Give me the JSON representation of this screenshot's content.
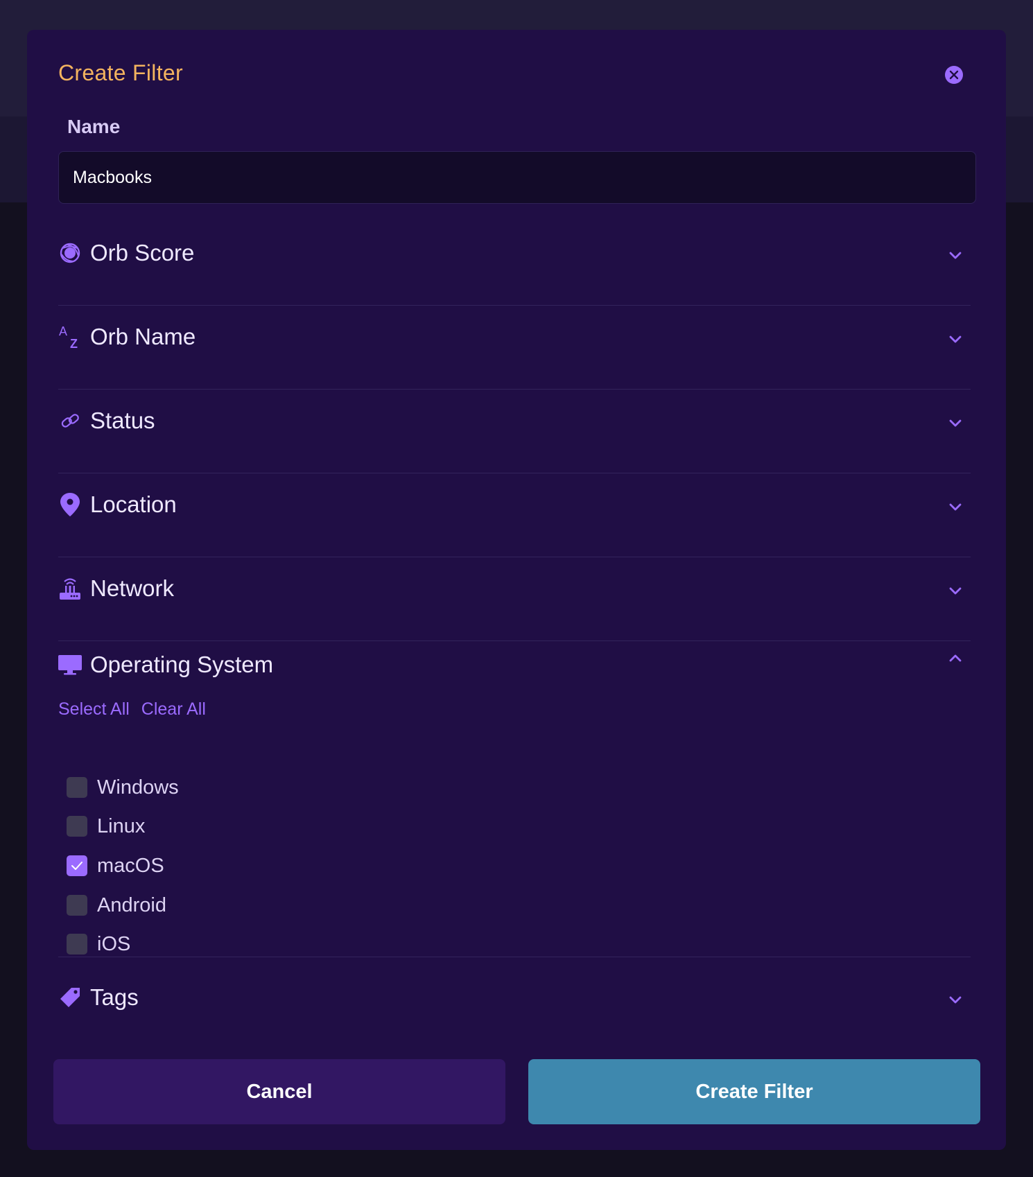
{
  "modal": {
    "title": "Create Filter",
    "name_label": "Name",
    "name_value": "Macbooks"
  },
  "sections": [
    {
      "label": "Orb Score",
      "icon": "orb-score-icon"
    },
    {
      "label": "Orb Name",
      "icon": "az-sort-icon"
    },
    {
      "label": "Status",
      "icon": "link-icon"
    },
    {
      "label": "Location",
      "icon": "map-pin-icon"
    },
    {
      "label": "Network",
      "icon": "router-icon"
    }
  ],
  "os": {
    "label": "Operating System",
    "icon": "monitor-icon",
    "select_all": "Select All",
    "clear_all": "Clear All",
    "options": [
      {
        "label": "Windows",
        "checked": false
      },
      {
        "label": "Linux",
        "checked": false
      },
      {
        "label": "macOS",
        "checked": true
      },
      {
        "label": "Android",
        "checked": false
      },
      {
        "label": "iOS",
        "checked": false
      }
    ]
  },
  "tags": {
    "label": "Tags",
    "icon": "tag-icon"
  },
  "buttons": {
    "cancel": "Cancel",
    "create": "Create Filter"
  },
  "colors": {
    "accent": "#9b6bff",
    "title": "#f3b35f",
    "primary_button": "#3e88ae",
    "secondary_button": "#321763"
  }
}
